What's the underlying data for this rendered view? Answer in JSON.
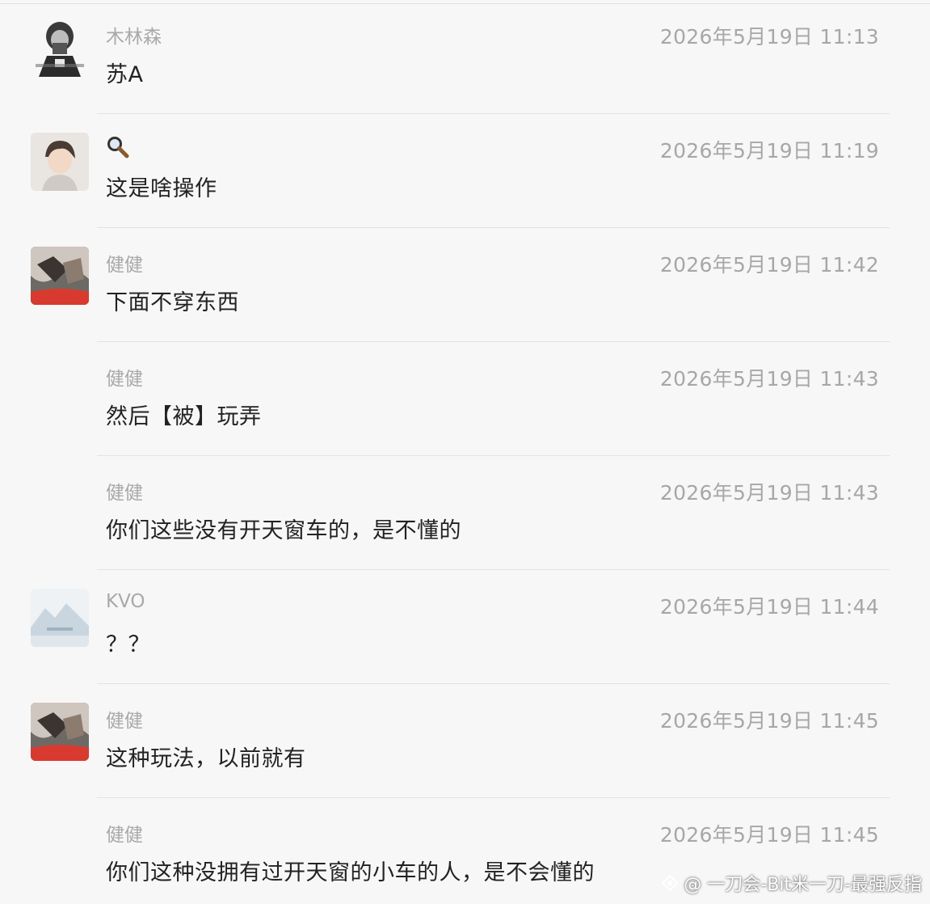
{
  "messages": [
    {
      "name": "木林森",
      "time": "2026年5月19日 11:13",
      "text": "苏A",
      "avatar": "sketch-avatar"
    },
    {
      "name": "",
      "time": "2026年5月19日 11:19",
      "text": "这是啥操作",
      "avatar": "person-avatar",
      "name_icon": "magnifier-icon"
    },
    {
      "name": "健健",
      "time": "2026年5月19日 11:42",
      "text": "下面不穿东西",
      "avatar": "photo-avatar"
    },
    {
      "name": "健健",
      "time": "2026年5月19日 11:43",
      "text": "然后【被】玩弄",
      "avatar": null
    },
    {
      "name": "健健",
      "time": "2026年5月19日 11:43",
      "text": "你们这些没有开天窗车的，是不懂的",
      "avatar": null
    },
    {
      "name": "KVO",
      "time": "2026年5月19日 11:44",
      "text": "？？",
      "avatar": "mountain-avatar"
    },
    {
      "name": "健健",
      "time": "2026年5月19日 11:45",
      "text": "这种玩法，以前就有",
      "avatar": "photo-avatar"
    },
    {
      "name": "健健",
      "time": "2026年5月19日 11:45",
      "text": "你们这种没拥有过开天窗的小车的人，是不会懂的",
      "avatar": null
    }
  ],
  "watermark": "@ 一刀会-Bit米一刀-最强反指",
  "colors": {
    "background": "#f7f7f7",
    "name": "#a9a9a9",
    "time": "#a7a7a7",
    "text": "#222222",
    "divider": "#e3e3e3"
  }
}
